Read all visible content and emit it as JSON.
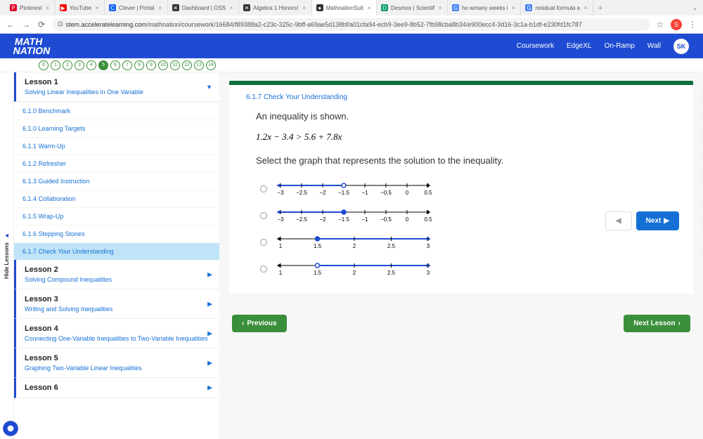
{
  "tabs": [
    {
      "icon": "P",
      "bg": "#e60023",
      "title": "Pinterest"
    },
    {
      "icon": "▶",
      "bg": "#ff0000",
      "title": "YouTube"
    },
    {
      "icon": "C",
      "bg": "#1464f4",
      "title": "Clever | Portal"
    },
    {
      "icon": "✕",
      "bg": "#333",
      "title": "Dashboard | OSS"
    },
    {
      "icon": "✕",
      "bg": "#333",
      "title": "Algebra 1 Honors!"
    },
    {
      "icon": "●",
      "bg": "#333",
      "title": "MathnationSuit",
      "active": true
    },
    {
      "icon": "D",
      "bg": "#0c9b6a",
      "title": "Desmos | Scientif"
    },
    {
      "icon": "G",
      "bg": "#4285f4",
      "title": "ho wmany weeks i"
    },
    {
      "icon": "G",
      "bg": "#4285f4",
      "title": "residual formula a"
    }
  ],
  "url": {
    "domain": "stem.acceleratelearning.com",
    "path": "/mathnation/coursework/16684/f89388a2-c23c-325c-9bff-a69ae5d138bf/a01cfa94-ecb9-3ee9-8b52-7fb98cba8b34/e900ecc4-3d16-3c1a-b1df-e230fd1fc787"
  },
  "profile": "S",
  "logo1": "MATH",
  "logo2": "NATION",
  "nav": [
    "Coursework",
    "EdgeXL",
    "On-Ramp",
    "Wall"
  ],
  "avatar": "SK",
  "hide": "Hide Lessons",
  "lessons": [
    {
      "t": "Lesson 1",
      "s": "Solving Linear Inequalities in One Variable",
      "open": true
    },
    {
      "t": "Lesson 2",
      "s": "Solving Compound Inequalities"
    },
    {
      "t": "Lesson 3",
      "s": "Writing and Solving Inequalities"
    },
    {
      "t": "Lesson 4",
      "s": "Connecting One-Variable Inequalities to Two-Variable Inequalities"
    },
    {
      "t": "Lesson 5",
      "s": "Graphing Two-Variable Linear Inequalities"
    },
    {
      "t": "Lesson 6",
      "s": ""
    }
  ],
  "items": [
    "6.1.0 Benchmark",
    "6.1.0 Learning Targets",
    "6.1.1 Warm-Up",
    "6.1.2 Refresher",
    "6.1.3 Guided Instruction",
    "6.1.4 Collaboration",
    "6.1.5 Wrap-Up",
    "6.1.6 Stepping Stones",
    "6.1.7 Check Your Understanding"
  ],
  "section": "6.1.7 Check Your Understanding",
  "q1": "An inequality is shown.",
  "eq": "1.2x − 3.4 > 5.6 + 7.8x",
  "q2": "Select the graph that represents the solution to the inequality.",
  "ticksA": [
    "−3",
    "−2.5",
    "−2",
    "−1.5",
    "−1",
    "−0.5",
    "0",
    "0.5"
  ],
  "ticksB": [
    "1",
    "1.5",
    "2",
    "2.5",
    "3"
  ],
  "prev": "Previous",
  "nextL": "Next Lesson",
  "next": "Next"
}
